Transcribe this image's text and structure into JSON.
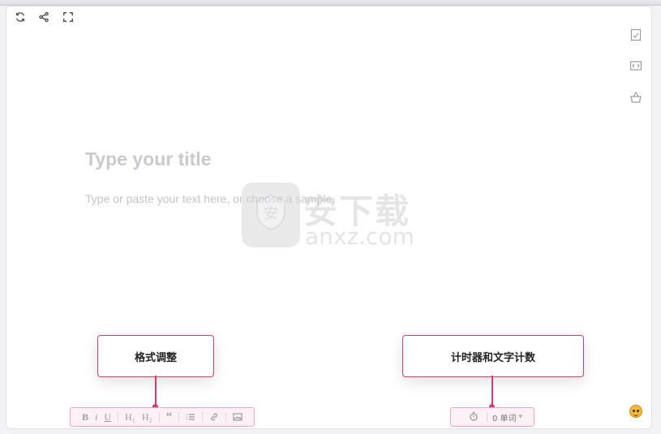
{
  "editor": {
    "title_placeholder": "Type your title",
    "body_placeholder": "Type or paste your text here, or choose a sample."
  },
  "top_toolbar": {
    "icons": [
      "refresh-icon",
      "share-icon",
      "fullscreen-icon"
    ]
  },
  "side_toolbar": {
    "icons": [
      "checklist-icon",
      "code-icon",
      "basket-icon"
    ]
  },
  "watermark": {
    "big_text": "安下载",
    "small_text": "anxz.com",
    "badge_char": "安"
  },
  "callouts": {
    "format": "格式调整",
    "counter": "计时器和文字计数"
  },
  "format_toolbar": {
    "bold": "B",
    "italic": "i",
    "underline": "U",
    "h1": "H₁",
    "h2": "H₂",
    "quote": "“"
  },
  "word_counter": {
    "label": "0 单词",
    "caret": "▾"
  },
  "colors": {
    "accent": "#d23c74",
    "highlight_border": "#f1a4c2"
  }
}
